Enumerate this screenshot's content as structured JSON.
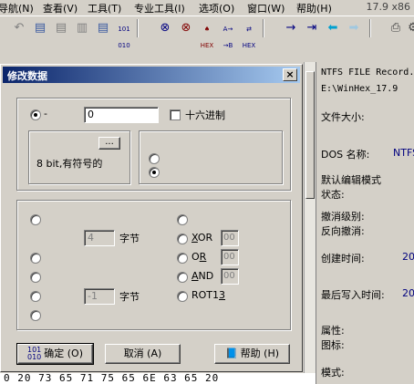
{
  "menubar": {
    "items": [
      "导航(N)",
      "查看(V)",
      "工具(T)",
      "专业工具(I)",
      "选项(O)",
      "窗口(W)",
      "帮助(H)"
    ],
    "version": "17.9 x86"
  },
  "toolbar": {
    "icons": [
      "undo-icon",
      "copy-icon",
      "cut-icon",
      "paste-icon",
      "paste-special-icon",
      "binary-icon",
      "find-icon",
      "find-next-icon",
      "find-hex-icon",
      "replace-icon",
      "replace-hex-icon",
      "goto-icon",
      "goto-offset-icon",
      "back-icon",
      "forward-icon",
      "print-icon",
      "settings-icon"
    ],
    "binary_label": "101\n010",
    "hex_label": "HEX"
  },
  "right_panel": {
    "title": "NTFS FILE Record.",
    "path": "E:\\WinHex_17.9",
    "file_size_label": "文件大小:",
    "dos_name_label": "DOS 名称:",
    "dos_name_value": "NTFS",
    "edit_mode_label": "默认编辑模式",
    "state_label": "状态:",
    "undo_level_label": "撤消级别:",
    "reverse_undo_label": "反向撤消:",
    "created_label": "创建时间:",
    "created_value": "20",
    "modified_label": "最后写入时间:",
    "modified_value": "20",
    "attr_label": "属性:",
    "icon_label": "图标:",
    "mode_label": "模式:"
  },
  "hex_row": "0 20 73 65 71 75  65 6E 63 65 20",
  "dialog": {
    "title": "修改数据",
    "close": "×",
    "op_radio_label": "-",
    "value": "0",
    "hex_checkbox_label": "十六进制",
    "type_label": "8 bit,有符号的",
    "type_button_label": "...",
    "bytes_value_1": "4",
    "bytes_label_1": "字节",
    "bytes_value_2": "-1",
    "bytes_label_2": "字节",
    "xor_label": "XOR",
    "or_label": "OR",
    "and_label": "AND",
    "rot_label": "ROT13",
    "xor_value": "00",
    "or_value": "00",
    "and_value": "00",
    "ok_label": "确定 (O)",
    "cancel_label": "取消 (A)",
    "help_label": "帮助 (H)",
    "ok_icon_text": "101\n010"
  }
}
